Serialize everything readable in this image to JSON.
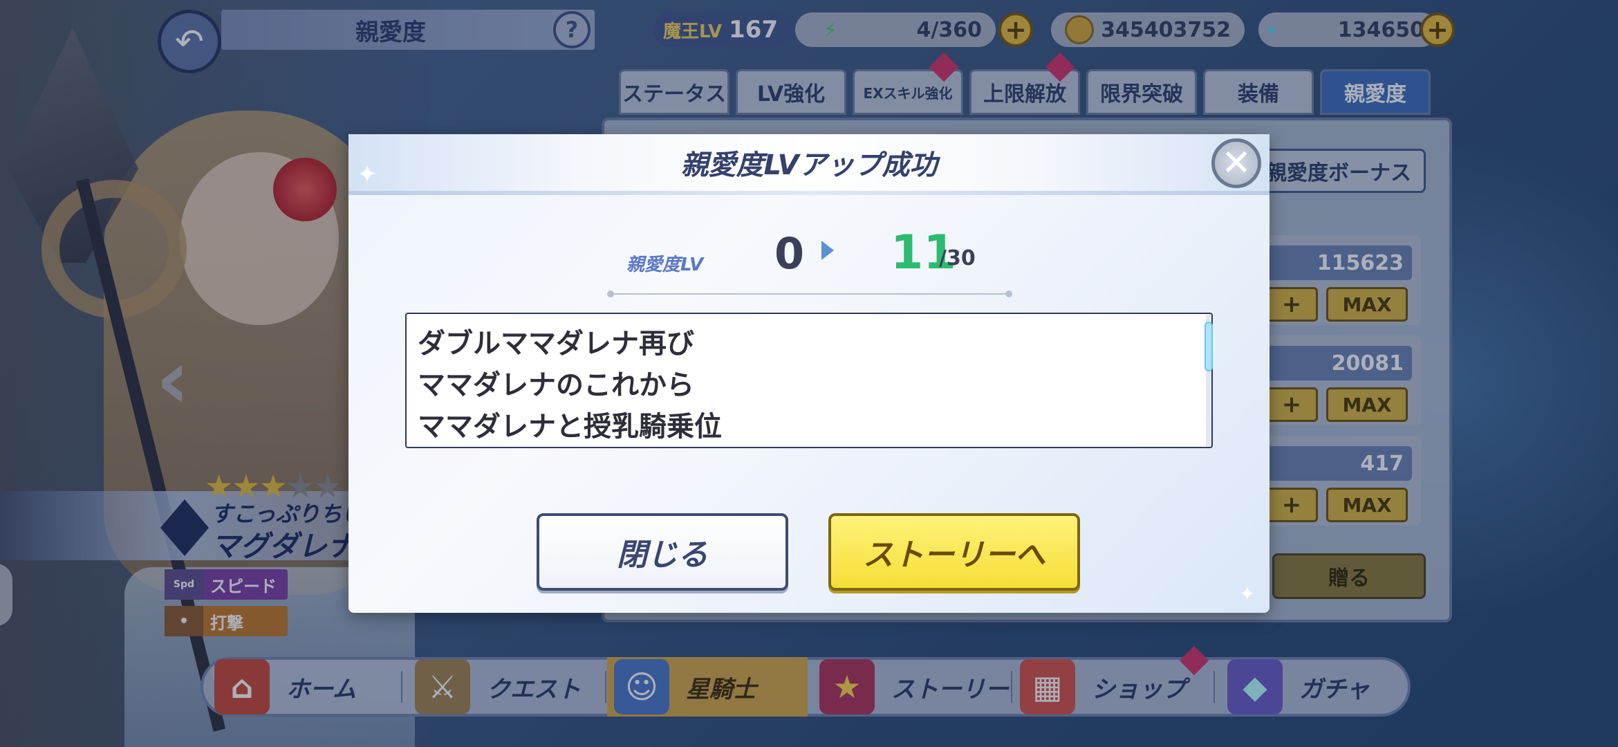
{
  "header": {
    "title": "親愛度",
    "help": "?",
    "back_icon": "back-arrow-icon",
    "demon_lv_label": "魔王LV",
    "demon_lv_value": "167",
    "stamina": "4/360",
    "gold": "345403752",
    "gems": "134650",
    "plus": "+"
  },
  "tabs": [
    {
      "label": "ステータス"
    },
    {
      "label": "LV強化"
    },
    {
      "label": "EXスキル強化"
    },
    {
      "label": "上限解放"
    },
    {
      "label": "限界突破"
    },
    {
      "label": "装備"
    },
    {
      "label": "親愛度"
    }
  ],
  "right_panel": {
    "bonus_button": "親愛度ボーナス",
    "rows": [
      {
        "value": "115623",
        "plus": "+",
        "max": "MAX"
      },
      {
        "value": "20081",
        "plus": "+",
        "max": "MAX"
      },
      {
        "value": "417",
        "plus": "+",
        "max": "MAX"
      }
    ],
    "gift_button": "贈る"
  },
  "character": {
    "stars_filled": 3,
    "stars_total": 5,
    "subtitle": "すこっぷりちい",
    "name": "マグダレナ",
    "traits": [
      {
        "icon": "Spd",
        "label": "スピード"
      },
      {
        "icon": "",
        "label": "打撃"
      }
    ]
  },
  "modal": {
    "title": "親愛度LVアップ成功",
    "close_symbol": "✕",
    "lv_label": "親愛度LV",
    "lv_old": "0",
    "lv_new": "11",
    "lv_max": "/30",
    "stories": [
      "ダブルママダレナ再び",
      "ママダレナのこれから",
      "ママダレナと授乳騎乗位"
    ],
    "close_button": "閉じる",
    "story_button": "ストーリーへ"
  },
  "nav": [
    {
      "label": "ホーム",
      "icon": "home-icon"
    },
    {
      "label": "クエスト",
      "icon": "quest-icon"
    },
    {
      "label": "星騎士",
      "icon": "star-knight-icon",
      "active": true
    },
    {
      "label": "ストーリー",
      "icon": "story-book-icon"
    },
    {
      "label": "ショップ",
      "icon": "shop-icon"
    },
    {
      "label": "ガチャ",
      "icon": "gacha-icon"
    }
  ],
  "colors": {
    "accent_green": "#2dbb6f",
    "story_button_yellow": "#f6de36",
    "active_tab_blue": "#3b6fbf",
    "badge_pink": "#d4336a"
  }
}
